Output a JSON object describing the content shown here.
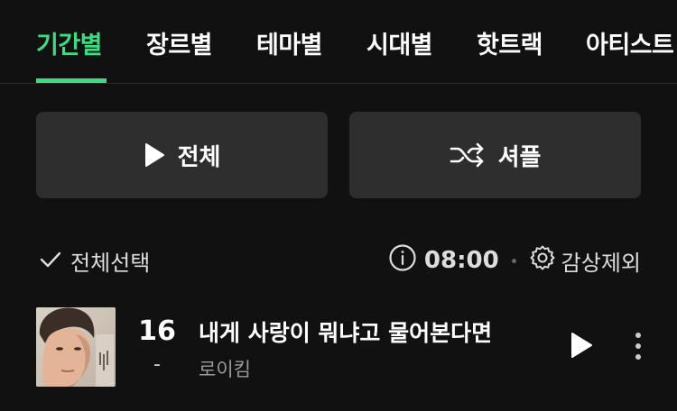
{
  "tabs": [
    {
      "label": "기간별",
      "active": true
    },
    {
      "label": "장르별",
      "active": false
    },
    {
      "label": "테마별",
      "active": false
    },
    {
      "label": "시대별",
      "active": false
    },
    {
      "label": "핫트랙",
      "active": false
    },
    {
      "label": "아티스트",
      "active": false
    }
  ],
  "actions": {
    "play_all_label": "전체",
    "shuffle_label": "셔플"
  },
  "selection": {
    "select_all_label": "전체선택",
    "timer_value": "08:00",
    "exclude_label": "감상제외"
  },
  "songs": [
    {
      "rank": "16",
      "rank_change": "-",
      "title": "내게 사랑이 뭐냐고 물어본다면",
      "artist": "로이킴"
    }
  ],
  "colors": {
    "accent": "#3ddc84",
    "background": "#111111",
    "button_bg": "#2e2e2e"
  },
  "icons": {
    "play": "play-icon",
    "shuffle": "shuffle-icon",
    "check": "check-icon",
    "info": "info-icon",
    "gear": "gear-icon",
    "more": "more-vertical-icon"
  }
}
